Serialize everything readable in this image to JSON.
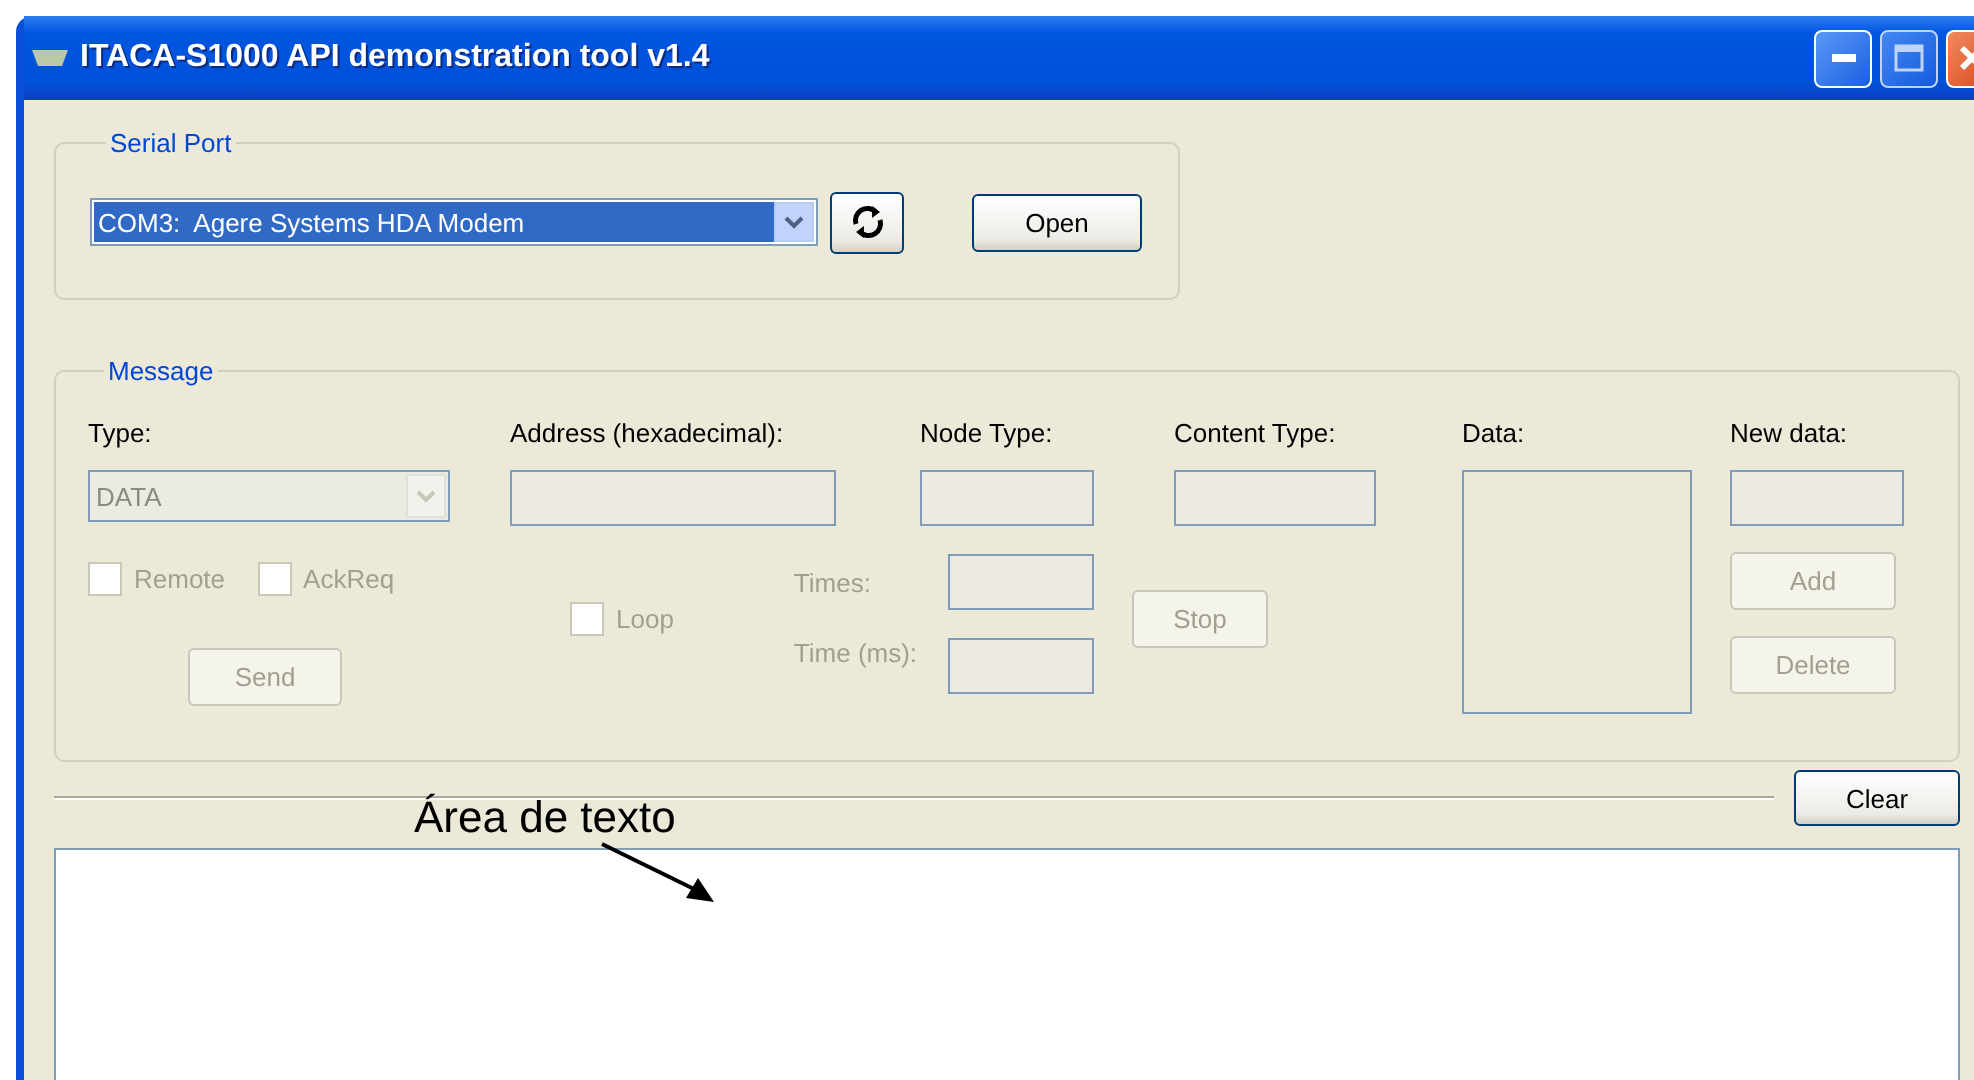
{
  "window": {
    "title": "ITACA-S1000 API demonstration tool v1.4"
  },
  "serial_port": {
    "title": "Serial Port",
    "port": {
      "value": "COM3:  Agere Systems HDA Modem",
      "focused": true
    },
    "open_button": {
      "label": "Open",
      "disabled": false
    }
  },
  "message": {
    "title": "Message",
    "type": {
      "label": "Type:",
      "value": "DATA",
      "disabled": true
    },
    "address": {
      "label": "Address (hexadecimal):",
      "disabled": true
    },
    "node_type": {
      "label": "Node Type:",
      "disabled": true
    },
    "content_type": {
      "label": "Content Type:",
      "disabled": true
    },
    "data": {
      "label": "Data:",
      "disabled": true
    },
    "new_data": {
      "label": "New data:",
      "disabled": true
    },
    "checkboxes": [
      {
        "label": "Remote",
        "checked": false,
        "disabled": true
      },
      {
        "label": "AckReq",
        "checked": false,
        "disabled": true
      },
      {
        "label": "Loop",
        "checked": false,
        "disabled": true
      }
    ],
    "times": {
      "label": "Times:",
      "disabled": true
    },
    "time_ms": {
      "label": "Time (ms):",
      "disabled": true
    },
    "send_button": {
      "label": "Send",
      "disabled": true
    },
    "stop_button": {
      "label": "Stop",
      "disabled": true
    },
    "add_button": {
      "label": "Add",
      "disabled": true
    },
    "delete_button": {
      "label": "Delete",
      "disabled": true
    }
  },
  "clear_button": {
    "label": "Clear",
    "disabled": false
  },
  "annotation": {
    "text": "Área de texto"
  }
}
